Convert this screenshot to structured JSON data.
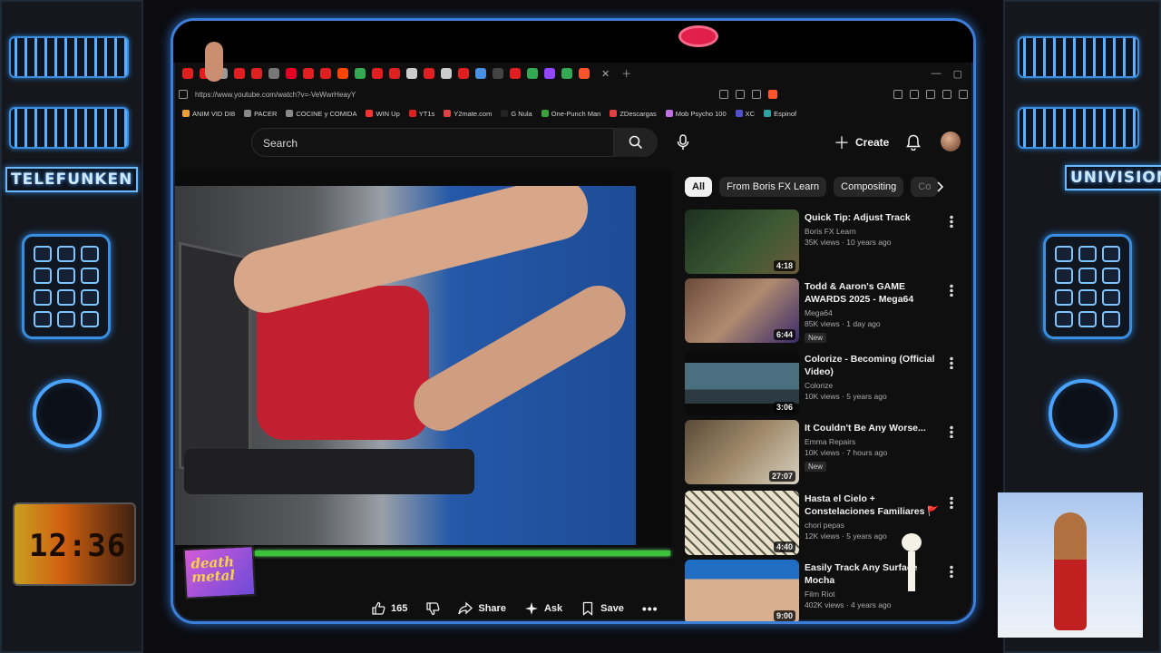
{
  "frame": {
    "left_brand": "TELEFUNKEN",
    "right_brand": "UNIVISION",
    "clock_time": "12:36"
  },
  "browser": {
    "url": "https://www.youtube.com/watch?v=-VeWwrHeayY",
    "bookmarks": [
      "ANIM VID DI8",
      "PACER",
      "COCINE y COMIDA",
      "WIN Up",
      "YT1s",
      "Y2mate.com",
      "G Nula",
      "One-Punch Man",
      "ZDescargas",
      "Mob Psycho 100",
      "XC",
      "Espinof"
    ]
  },
  "header": {
    "search_placeholder": "Search",
    "create_label": "Create"
  },
  "player": {
    "sticker_text": "death metal",
    "progress": 1.0
  },
  "actions": {
    "like_count": "165",
    "share_label": "Share",
    "ask_label": "Ask",
    "save_label": "Save"
  },
  "chips": [
    "All",
    "From Boris FX Learn",
    "Compositing",
    "Co"
  ],
  "recommendations": [
    {
      "title": "Quick Tip: Adjust Track",
      "channel": "Boris FX Learn",
      "meta": "35K views · 10 years ago",
      "duration": "4:18",
      "badge": "",
      "thumb_color": "#2f4a2a"
    },
    {
      "title": "Todd & Aaron's GAME AWARDS 2025 - Mega64",
      "channel": "Mega64",
      "meta": "85K views · 1 day ago",
      "duration": "6:44",
      "badge": "New",
      "thumb_color": "#7a5a48"
    },
    {
      "title": "Colorize - Becoming (Official Video)",
      "channel": "Colorize",
      "meta": "10K views · 5 years ago",
      "duration": "3:06",
      "badge": "",
      "thumb_color": "#3d5a6a"
    },
    {
      "title": "It Couldn't Be Any Worse...",
      "channel": "Emma Repairs",
      "meta": "10K views · 7 hours ago",
      "duration": "27:07",
      "badge": "New",
      "thumb_color": "#8a7a64"
    },
    {
      "title": "Hasta el Cielo + Constelaciones Familiares 🚩🏠 Chori Pepas",
      "channel": "chori pepas",
      "meta": "12K views · 5 years ago",
      "duration": "4:40",
      "badge": "",
      "thumb_color": "#d9d2b8"
    },
    {
      "title": "Easily Track Any Surface Mocha",
      "channel": "Film Riot",
      "meta": "402K views · 4 years ago",
      "duration": "9:00",
      "badge": "",
      "thumb_color": "#2b78c8"
    }
  ]
}
